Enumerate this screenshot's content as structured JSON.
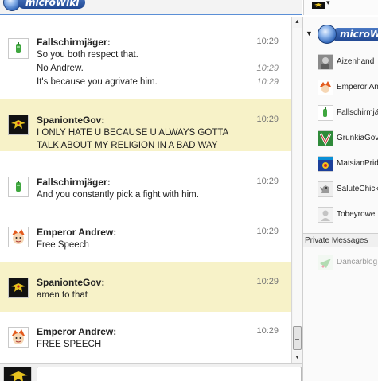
{
  "app": {
    "logo_text": "microWiki"
  },
  "chat": {
    "messages": [
      {
        "author": "Fallschirmjäger:",
        "avatar": "green-figure-icon",
        "highlight": false,
        "lines": [
          {
            "text": "So you both respect that.",
            "time": "10:29",
            "italic_time": false
          },
          {
            "text": "No Andrew.",
            "time": "10:29",
            "italic_time": true
          },
          {
            "text": "It's because you agrivate him.",
            "time": "10:29",
            "italic_time": true
          }
        ]
      },
      {
        "author": "SpanionteGov:",
        "avatar": "eagle-flag-icon",
        "highlight": true,
        "lines": [
          {
            "text": "I ONLY HATE U BECAUSE U ALWAYS GOTTA TALK ABOUT MY RELIGION IN A BAD WAY",
            "time": "10:29",
            "italic_time": false
          }
        ]
      },
      {
        "author": "Fallschirmjäger:",
        "avatar": "green-figure-icon",
        "highlight": false,
        "lines": [
          {
            "text": "And you constantly pick a fight with him.",
            "time": "10:29",
            "italic_time": false
          }
        ]
      },
      {
        "author": "Emperor Andrew:",
        "avatar": "cartoon-face-icon",
        "highlight": false,
        "lines": [
          {
            "text": "Free Speech",
            "time": "10:29",
            "italic_time": false
          }
        ]
      },
      {
        "author": "SpanionteGov:",
        "avatar": "eagle-flag-icon",
        "highlight": true,
        "lines": [
          {
            "text": "amen to that",
            "time": "10:29",
            "italic_time": false
          }
        ]
      },
      {
        "author": "Emperor Andrew:",
        "avatar": "cartoon-face-icon",
        "highlight": false,
        "lines": [
          {
            "text": "FREE SPEECH",
            "time": "10:29",
            "italic_time": false
          }
        ]
      }
    ]
  },
  "composer": {
    "value": "",
    "placeholder": ""
  },
  "sidebar": {
    "room_title": "microWiki",
    "users": [
      {
        "name": "Aizenhand",
        "avatar": "portrait-icon"
      },
      {
        "name": "Emperor Andrew",
        "avatar": "cartoon-face-icon"
      },
      {
        "name": "Fallschirmjäger",
        "avatar": "green-figure-icon"
      },
      {
        "name": "GrunkiaGovernment",
        "avatar": "grunkia-flag-icon"
      },
      {
        "name": "MatsianPride",
        "avatar": "matsian-badge-icon"
      },
      {
        "name": "SaluteChicken",
        "avatar": "chicken-icon"
      },
      {
        "name": "Tobeyrowe",
        "avatar": "default-user-icon"
      }
    ],
    "private_messages_label": "Private Messages",
    "private_messages": [
      {
        "name": "Dancarblog",
        "avatar": "star-icon"
      }
    ]
  },
  "colors": {
    "highlight_bg": "#f7f2c8",
    "accent": "#5b8fd6",
    "logo_blue": "#1f4690"
  }
}
